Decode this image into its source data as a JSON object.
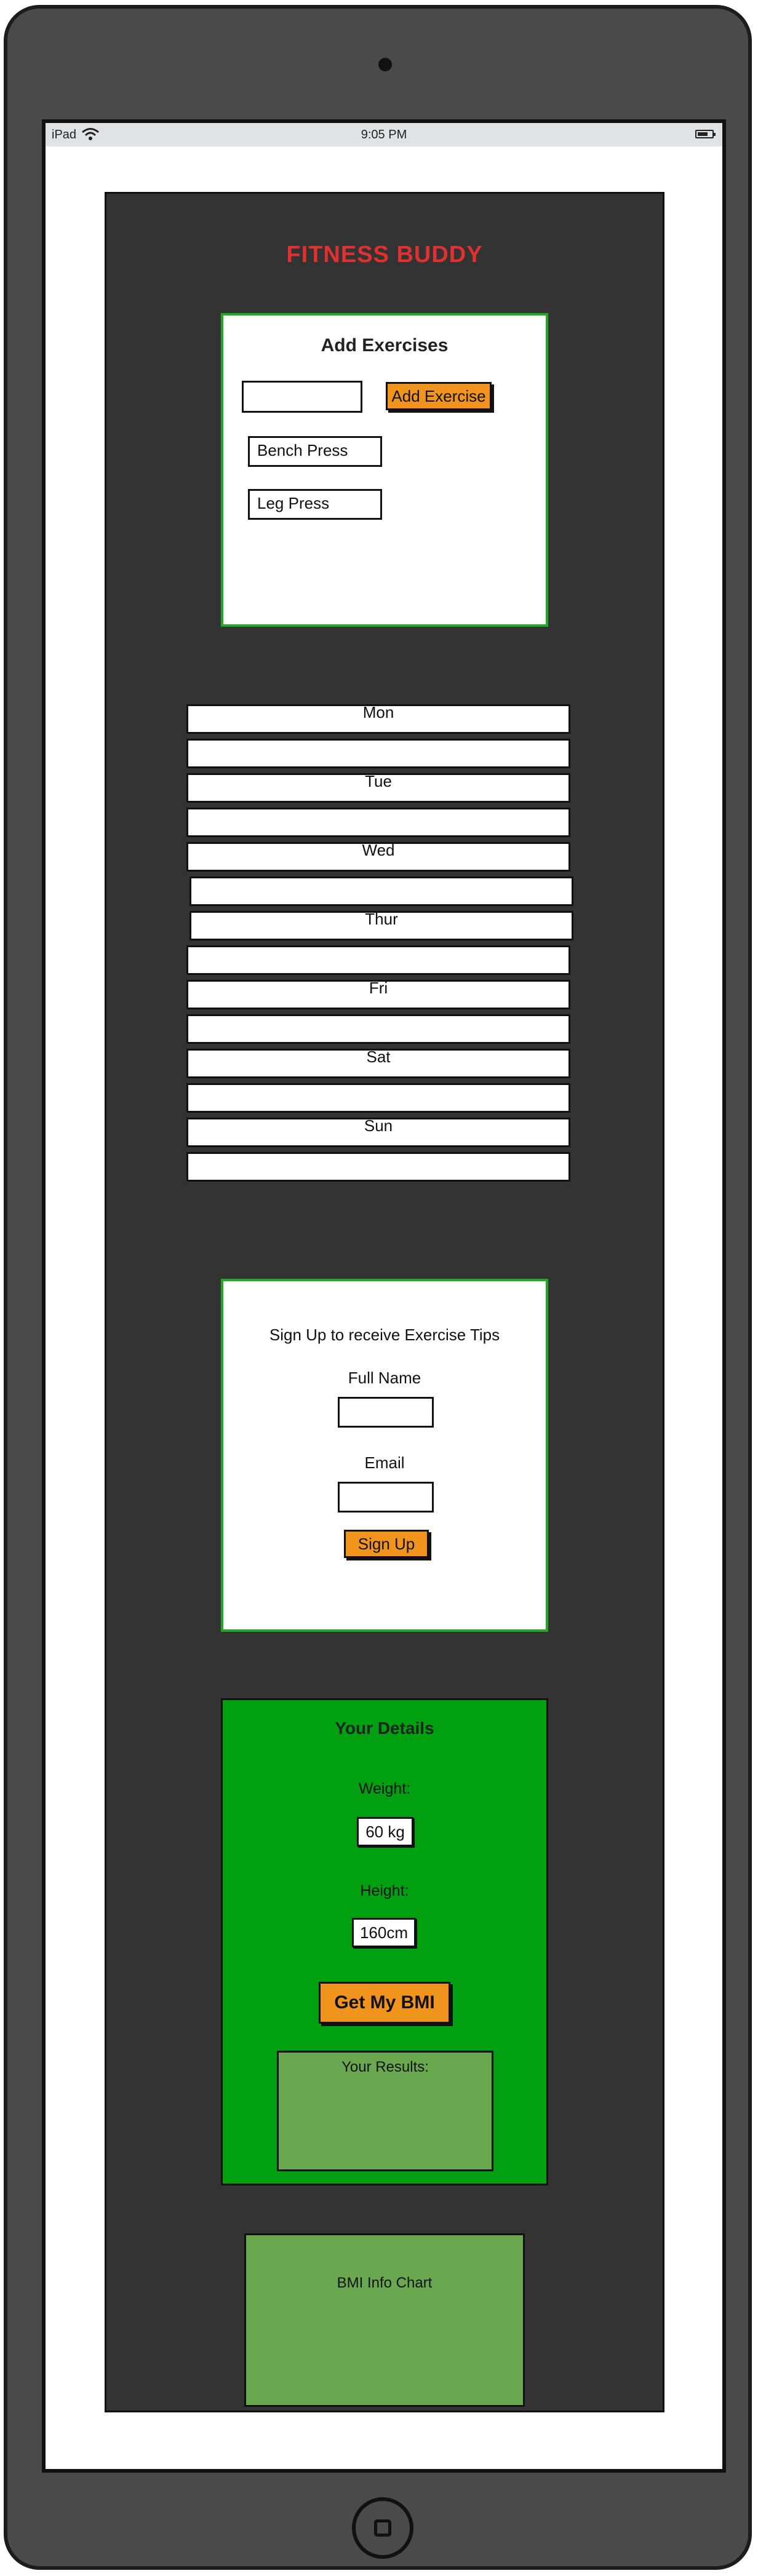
{
  "device": {
    "statusbar": {
      "carrier": "iPad",
      "time": "9:05 PM"
    }
  },
  "app": {
    "title": "FITNESS BUDDY",
    "add_exercises": {
      "title": "Add Exercises",
      "input_value": "",
      "button_label": "Add Exercise",
      "items": [
        "Bench Press",
        "Leg Press"
      ]
    },
    "week": {
      "rows": [
        {
          "label": "Mon"
        },
        {
          "label": ""
        },
        {
          "label": "Tue"
        },
        {
          "label": ""
        },
        {
          "label": "Wed"
        },
        {
          "label": ""
        },
        {
          "label": "Thur"
        },
        {
          "label": ""
        },
        {
          "label": "Fri"
        },
        {
          "label": ""
        },
        {
          "label": "Sat"
        },
        {
          "label": ""
        },
        {
          "label": "Sun"
        },
        {
          "label": ""
        }
      ]
    },
    "signup": {
      "title": "Sign Up to receive Exercise Tips",
      "full_name_label": "Full Name",
      "full_name_value": "",
      "email_label": "Email",
      "email_value": "",
      "button_label": "Sign Up"
    },
    "details": {
      "title": "Your Details",
      "weight_label": "Weight:",
      "weight_value": "60 kg",
      "height_label": "Height:",
      "height_value": "160cm",
      "button_label": "Get My BMI",
      "results_label": "Your Results:"
    },
    "bmi_chart": {
      "label": "BMI Info Chart"
    }
  },
  "colors": {
    "title_red": "#e03030",
    "card_border_green": "#22aa22",
    "button_orange": "#f0941e",
    "details_green": "#00a010",
    "results_green": "#6aa84f",
    "panel_dark": "#333333"
  }
}
